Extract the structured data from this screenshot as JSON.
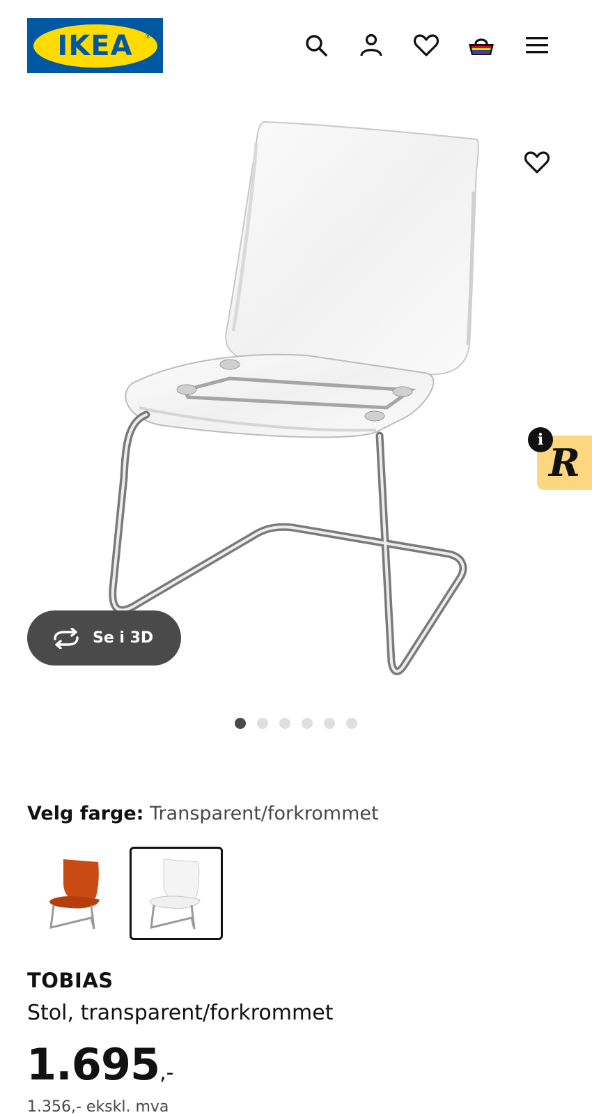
{
  "header": {
    "logo_text": "IKEA",
    "logo_reg": "®",
    "icons": [
      "search-icon",
      "account-icon",
      "heart-icon",
      "basket-icon",
      "menu-icon"
    ]
  },
  "gallery": {
    "view_3d_label": "Se i 3D",
    "image_count": 6,
    "active_image": 1,
    "badge_letter": "R",
    "info_glyph": "i"
  },
  "color": {
    "label": "Velg farge:",
    "value": "Transparent/forkrommet",
    "options": [
      "orange",
      "transparent"
    ],
    "selected": 1
  },
  "product": {
    "name": "TOBIAS",
    "description": "Stol, transparent/forkrommet",
    "price": "1.695",
    "price_suffix": ",-",
    "price_excl_vat": "1.356,- ekskl. mva"
  },
  "colors": {
    "brand_blue": "#0058a3",
    "brand_yellow": "#ffdb00",
    "dark_button": "#4a4a4a",
    "badge_yellow": "#fcd77f"
  }
}
